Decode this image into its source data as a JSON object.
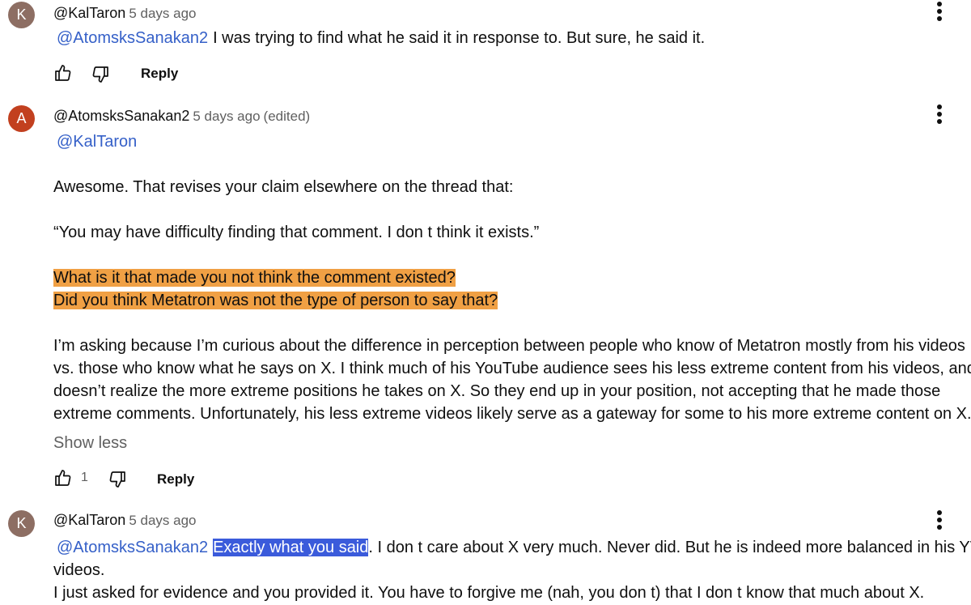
{
  "comments": [
    {
      "avatar_letter": "K",
      "author": "@KalTaron",
      "time": "5 days ago",
      "mention": "@AtomsksSanakan2",
      "text": "I was trying to find what he said it in response to. But sure, he said it.",
      "reply_label": "Reply"
    },
    {
      "avatar_letter": "A",
      "author": "@AtomsksSanakan2",
      "time": "5 days ago",
      "edited": "(edited)",
      "mention": "@KalTaron",
      "paragraph1": "Awesome. That revises your claim elsewhere on the thread that:",
      "paragraph2": "“You may have difficulty finding that comment. I don t think it exists.”",
      "highlight_line1": "What is it that made you not think the comment existed?",
      "highlight_line2": "Did you think Metatron was not the type of person to say that?",
      "paragraph3_line1": "I’m asking because I’m curious about the difference in perception between people who know of Metatron mostly from his videos",
      "paragraph3_line2": "vs. those who know what he says on X. I think much of his YouTube audience sees his less extreme content from his videos, and",
      "paragraph3_line3": "doesn’t realize the more extreme positions he takes on X. So they end up in your position, not accepting that he made those",
      "paragraph3_line4": "extreme comments. Unfortunately, his less extreme videos likely serve as a gateway for some to his more extreme content on X.",
      "show_less_label": "Show less",
      "like_count": "1",
      "reply_label": "Reply"
    },
    {
      "avatar_letter": "K",
      "author": "@KalTaron",
      "time": "5 days ago",
      "mention": "@AtomsksSanakan2",
      "selected_text": "Exactly what you said",
      "text_after_selection": ". I don t care about X very much. Never did. But he is indeed more balanced in his YT",
      "line2": "videos.",
      "line3": "I just asked for evidence and you provided it. You have to forgive me (nah, you don t) that I don t know that much about X."
    }
  ],
  "icons": {
    "like": "thumbs-up-icon",
    "dislike": "thumbs-down-icon",
    "menu": "more-vert-icon"
  },
  "colors": {
    "mention": "#3560c8",
    "highlight_orange": "#f0a044",
    "selection_blue": "#3b5bdb",
    "secondary_text": "#606060"
  }
}
